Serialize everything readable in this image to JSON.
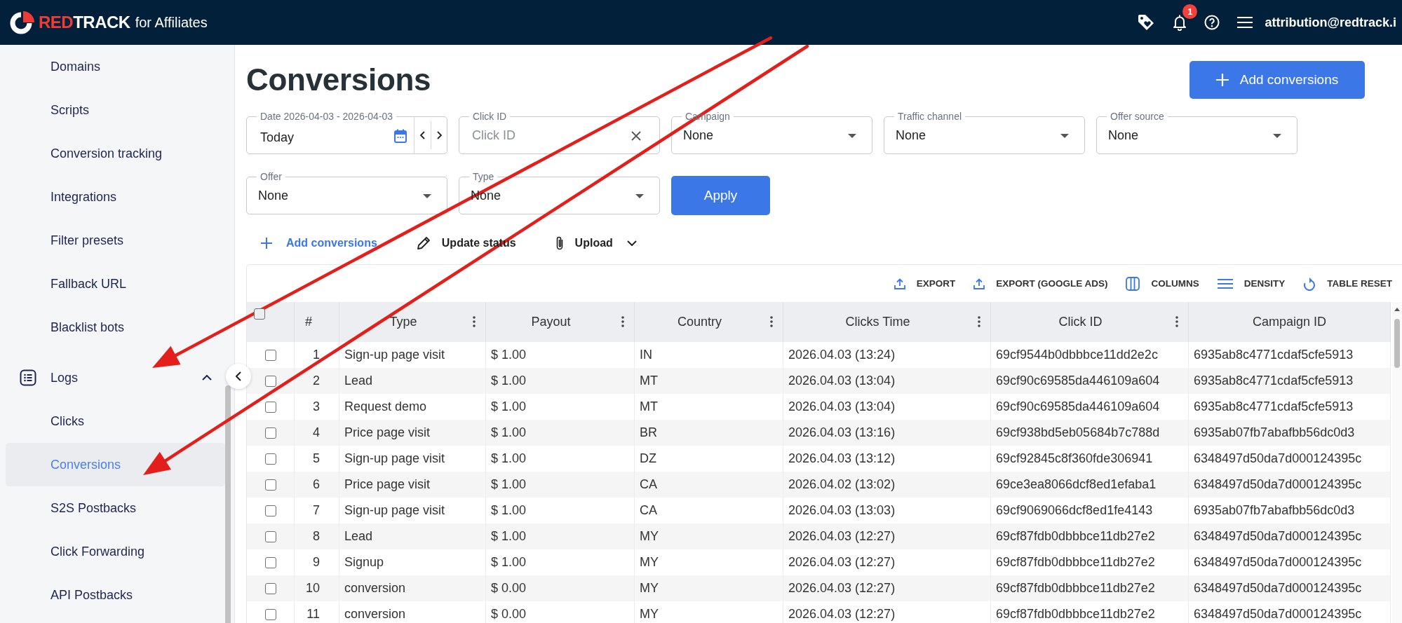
{
  "top_bar": {
    "brand": {
      "accent": "RED",
      "name": "TRACK",
      "tagline": "for Affiliates"
    },
    "notification_count": "1",
    "account": "attribution@redtrack.i"
  },
  "sidebar": {
    "items": [
      {
        "kind": "link",
        "label": "Domains",
        "selected": false
      },
      {
        "kind": "link",
        "label": "Scripts",
        "selected": false
      },
      {
        "kind": "link",
        "label": "Conversion tracking",
        "selected": false
      },
      {
        "kind": "link",
        "label": "Integrations",
        "selected": false
      },
      {
        "kind": "link",
        "label": "Filter presets",
        "selected": false
      },
      {
        "kind": "link",
        "label": "Fallback URL",
        "selected": false
      },
      {
        "kind": "link",
        "label": "Blacklist bots",
        "selected": false
      },
      {
        "kind": "section",
        "label": "Logs",
        "expanded": true,
        "children": [
          {
            "label": "Clicks",
            "selected": false
          },
          {
            "label": "Conversions",
            "selected": true
          },
          {
            "label": "S2S Postbacks",
            "selected": false
          },
          {
            "label": "Click Forwarding",
            "selected": false
          },
          {
            "label": "API Postbacks",
            "selected": false
          }
        ]
      }
    ]
  },
  "page": {
    "title": "Conversions",
    "primary_action": "Add conversions"
  },
  "filters": [
    {
      "kind": "date",
      "label": "Date 2026-04-03 - 2026-04-03",
      "value": "Today"
    },
    {
      "kind": "text",
      "label": "Click ID",
      "placeholder": "Click ID"
    },
    {
      "kind": "select",
      "label": "Campaign",
      "value": "None"
    },
    {
      "kind": "select",
      "label": "Traffic channel",
      "value": "None"
    },
    {
      "kind": "select",
      "label": "Offer source",
      "value": "None"
    },
    {
      "kind": "select",
      "label": "Offer",
      "value": "None"
    },
    {
      "kind": "select",
      "label": "Type",
      "value": "None"
    }
  ],
  "apply_button": "Apply",
  "actions": [
    {
      "kind": "add",
      "label": "Add conversions"
    },
    {
      "kind": "edit",
      "label": "Update status"
    },
    {
      "kind": "upload",
      "label": "Upload"
    }
  ],
  "table": {
    "toolbar": [
      {
        "kind": "export",
        "label": "EXPORT"
      },
      {
        "kind": "export",
        "label": "EXPORT (GOOGLE ADS)"
      },
      {
        "kind": "columns",
        "label": "COLUMNS"
      },
      {
        "kind": "density",
        "label": "DENSITY"
      },
      {
        "kind": "reset",
        "label": "TABLE RESET"
      }
    ],
    "select_all_checked": false,
    "columns": [
      {
        "label": "#",
        "menu": false
      },
      {
        "label": "Type",
        "menu": true
      },
      {
        "label": "Payout",
        "menu": true
      },
      {
        "label": "Country",
        "menu": true
      },
      {
        "label": "Clicks Time",
        "menu": true
      },
      {
        "label": "Click ID",
        "menu": true
      },
      {
        "label": "Campaign ID",
        "menu": false
      }
    ],
    "rows": [
      {
        "checked": false,
        "cells": [
          "1",
          "Sign-up page visit",
          "$ 1.00",
          "IN",
          "2026.04.03 (13:24)",
          "69cf9544b0dbbbce11dd2e2c",
          "6935ab8c4771cdaf5cfe5913"
        ]
      },
      {
        "checked": false,
        "cells": [
          "2",
          "Lead",
          "$ 1.00",
          "MT",
          "2026.04.03 (13:04)",
          "69cf90c69585da446109a604",
          "6935ab8c4771cdaf5cfe5913"
        ]
      },
      {
        "checked": false,
        "cells": [
          "3",
          "Request demo",
          "$ 1.00",
          "MT",
          "2026.04.03 (13:04)",
          "69cf90c69585da446109a604",
          "6935ab8c4771cdaf5cfe5913"
        ]
      },
      {
        "checked": false,
        "cells": [
          "4",
          "Price page visit",
          "$ 1.00",
          "BR",
          "2026.04.03 (13:16)",
          "69cf938bd5eb05684b7c788d",
          "6935ab07fb7abafbb56dc0d3"
        ]
      },
      {
        "checked": false,
        "cells": [
          "5",
          "Sign-up page visit",
          "$ 1.00",
          "DZ",
          "2026.04.03 (13:12)",
          "69cf92845c8f360fde306941",
          "6348497d50da7d000124395c"
        ]
      },
      {
        "checked": false,
        "cells": [
          "6",
          "Price page visit",
          "$ 1.00",
          "CA",
          "2026.04.02 (13:02)",
          "69ce3ea8066dcf8ed1efaba1",
          "6348497d50da7d000124395c"
        ]
      },
      {
        "checked": false,
        "cells": [
          "7",
          "Sign-up page visit",
          "$ 1.00",
          "CA",
          "2026.04.03 (13:03)",
          "69cf9069066dcf8ed1fe4143",
          "6935ab07fb7abafbb56dc0d3"
        ]
      },
      {
        "checked": false,
        "cells": [
          "8",
          "Lead",
          "$ 1.00",
          "MY",
          "2026.04.03 (12:27)",
          "69cf87fdb0dbbbce11db27e2",
          "6348497d50da7d000124395c"
        ]
      },
      {
        "checked": false,
        "cells": [
          "9",
          "Signup",
          "$ 1.00",
          "MY",
          "2026.04.03 (12:27)",
          "69cf87fdb0dbbbce11db27e2",
          "6348497d50da7d000124395c"
        ]
      },
      {
        "checked": false,
        "cells": [
          "10",
          "conversion",
          "$ 0.00",
          "MY",
          "2026.04.03 (12:27)",
          "69cf87fdb0dbbbce11db27e2",
          "6348497d50da7d000124395c"
        ]
      },
      {
        "checked": false,
        "cells": [
          "11",
          "conversion",
          "$ 0.00",
          "MY",
          "2026.04.03 (12:27)",
          "69cf87fdb0dbbbce11db27e2",
          "6348497d50da7d000124395c"
        ]
      }
    ]
  },
  "annotations": [
    {
      "kind": "arrow"
    },
    {
      "kind": "arrow"
    }
  ]
}
